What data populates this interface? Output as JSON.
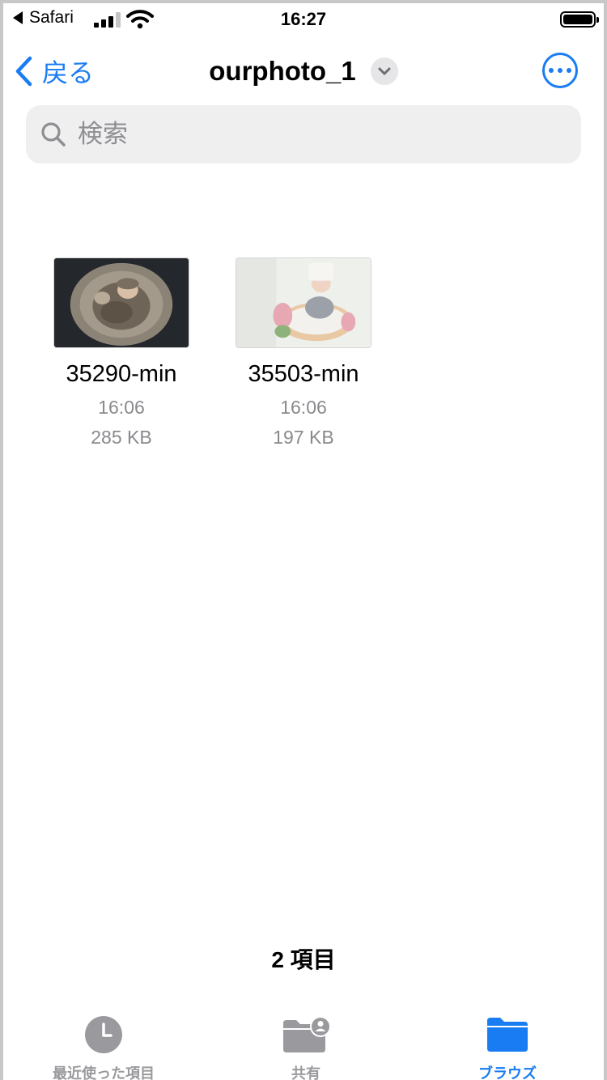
{
  "status_bar": {
    "back_app": "Safari",
    "time": "16:27"
  },
  "nav": {
    "back_label": "戻る",
    "title": "ourphoto_1"
  },
  "search": {
    "placeholder": "検索"
  },
  "files": [
    {
      "name": "35290-min",
      "time": "16:06",
      "size": "285 KB"
    },
    {
      "name": "35503-min",
      "time": "16:06",
      "size": "197 KB"
    }
  ],
  "item_count": "2 項目",
  "tabs": [
    {
      "label": "最近使った項目",
      "icon": "clock-icon",
      "active": false
    },
    {
      "label": "共有",
      "icon": "shared-folder-icon",
      "active": false
    },
    {
      "label": "ブラウズ",
      "icon": "folder-icon",
      "active": true
    }
  ],
  "colors": {
    "accent": "#1a7cf2",
    "inactive": "#9a9a9e",
    "search_bg": "#efeff0"
  }
}
